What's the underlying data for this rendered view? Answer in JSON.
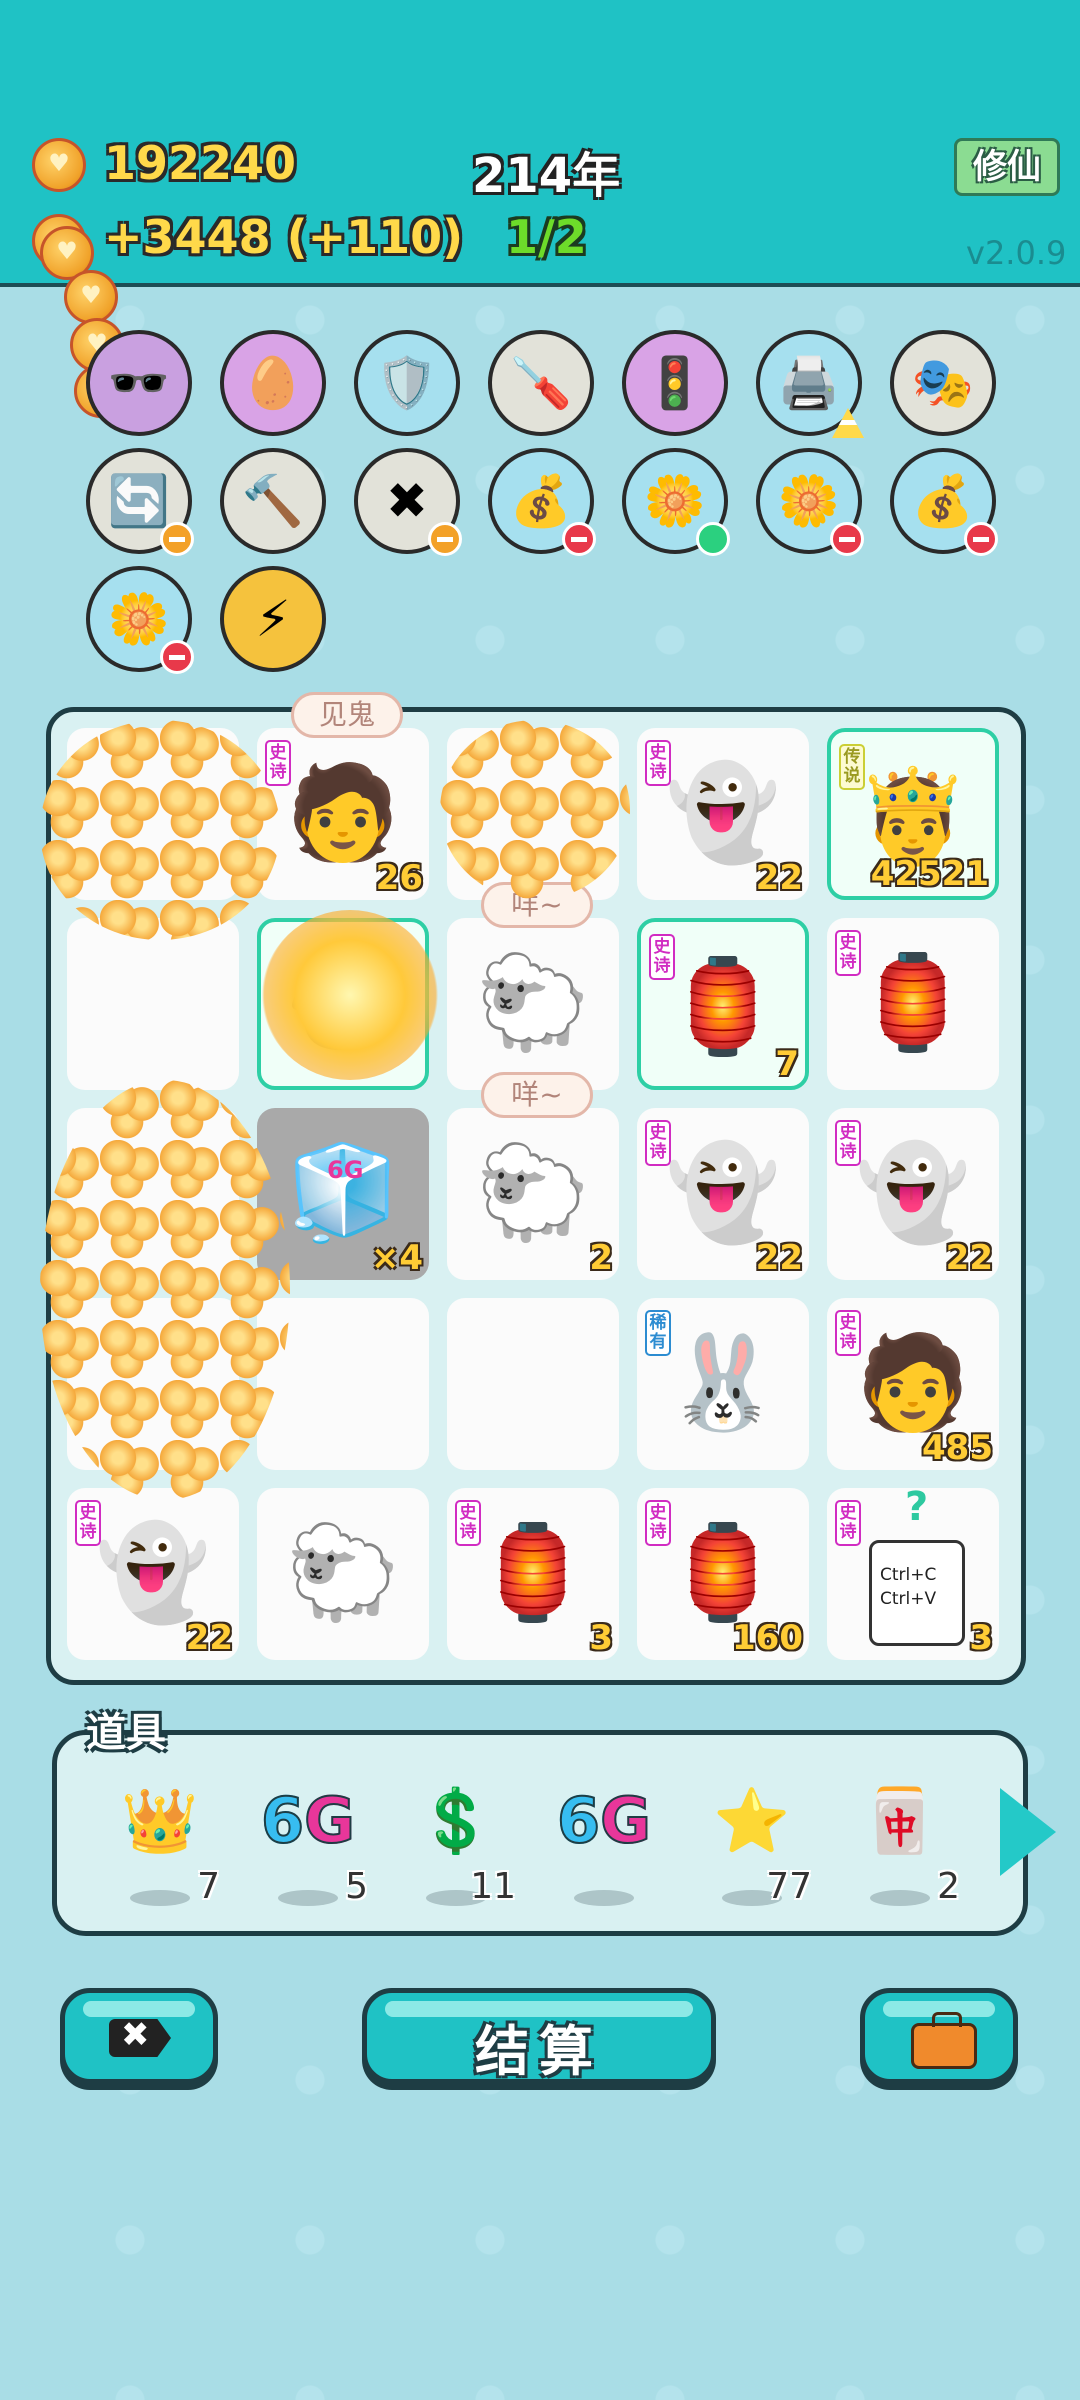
{
  "header": {
    "coins": "192240",
    "income": "+3448 (+110)",
    "year": "214年",
    "progress": "1/2",
    "mode_button": "修仙",
    "version": "v2.0.9"
  },
  "relics": [
    {
      "icon": "sunglasses-icon",
      "glyph": "🕶️",
      "bg": "#c9a0e0"
    },
    {
      "icon": "egg-icon",
      "glyph": "🥚",
      "bg": "#d9a3e6"
    },
    {
      "icon": "shield-wrench-icon",
      "glyph": "🛡️",
      "bg": "#a6e0ef"
    },
    {
      "icon": "screwdriver-icon",
      "glyph": "🪛",
      "bg": "#e2e2d9"
    },
    {
      "icon": "traffic-light-ghost-icon",
      "glyph": "🚦",
      "bg": "#d9a3e6"
    },
    {
      "icon": "printer-icon",
      "glyph": "🖨️",
      "bg": "#a6e0ef",
      "mark": "warn"
    },
    {
      "icon": "golden-mask-icon",
      "glyph": "🎭",
      "bg": "#e2e2d9"
    },
    {
      "icon": "recycle-icon",
      "glyph": "🔄",
      "bg": "#e2e2d9",
      "mark": "heart"
    },
    {
      "icon": "hammer-icon",
      "glyph": "🔨",
      "bg": "#e2e2d9"
    },
    {
      "icon": "remove-tag-icon",
      "glyph": "✖",
      "bg": "#e2e2d9",
      "mark": "heart"
    },
    {
      "icon": "money-bag-icon",
      "glyph": "💰",
      "bg": "#a6e0ef",
      "mark": "minus"
    },
    {
      "icon": "flower-pot-icon",
      "glyph": "🌼",
      "bg": "#a6e0ef",
      "mark": "green"
    },
    {
      "icon": "flower-pot-icon",
      "glyph": "🌼",
      "bg": "#a6e0ef",
      "mark": "minus"
    },
    {
      "icon": "money-bag-icon",
      "glyph": "💰",
      "bg": "#a6e0ef",
      "mark": "minus"
    },
    {
      "icon": "flower-pot-icon",
      "glyph": "🌼",
      "bg": "#a6e0ef",
      "mark": "minus"
    },
    {
      "icon": "lightning-icon",
      "glyph": "⚡",
      "bg": "#f5c23d"
    }
  ],
  "board": {
    "cells": [
      {
        "name": "empty",
        "tag": "",
        "glyph": "",
        "num": ""
      },
      {
        "name": "ghost-man",
        "tag": "史诗",
        "glyph": "🧑",
        "num": "26",
        "bubble": "见鬼"
      },
      {
        "name": "empty",
        "tag": "",
        "glyph": "",
        "num": ""
      },
      {
        "name": "ghost",
        "tag": "史诗",
        "glyph": "👻",
        "num": "22"
      },
      {
        "name": "king",
        "tag": "传说",
        "glyph": "🤴",
        "num": "42521",
        "hl": true
      },
      {
        "name": "empty",
        "tag": "",
        "glyph": "",
        "num": ""
      },
      {
        "name": "pressure-cooker",
        "tag": "",
        "glyph": "🍲",
        "num": "",
        "hl": true
      },
      {
        "name": "sheep",
        "tag": "",
        "glyph": "🐑",
        "num": "",
        "bubble": "咩~"
      },
      {
        "name": "rabbit-house",
        "tag": "史诗",
        "glyph": "🏮",
        "num": "7",
        "hl": true
      },
      {
        "name": "rabbit-house",
        "tag": "史诗",
        "glyph": "🏮",
        "num": ""
      },
      {
        "name": "empty",
        "tag": "",
        "glyph": "",
        "num": ""
      },
      {
        "name": "6g-fridge",
        "tag": "",
        "glyph": "🧊",
        "num": "×4",
        "gray": true,
        "label": "6G"
      },
      {
        "name": "sheep",
        "tag": "",
        "glyph": "🐑",
        "num": "2",
        "bubble": "咩~"
      },
      {
        "name": "ghost",
        "tag": "史诗",
        "glyph": "👻",
        "num": "22"
      },
      {
        "name": "ghost",
        "tag": "史诗",
        "glyph": "👻",
        "num": "22"
      },
      {
        "name": "ghost",
        "tag": "",
        "glyph": "",
        "num": ""
      },
      {
        "name": "empty",
        "tag": "",
        "glyph": "",
        "num": ""
      },
      {
        "name": "empty",
        "tag": "",
        "glyph": "",
        "num": ""
      },
      {
        "name": "rabbit",
        "tag": "稀有",
        "glyph": "🐰",
        "num": "",
        "rare": true
      },
      {
        "name": "ghost-man",
        "tag": "史诗",
        "glyph": "🧑",
        "num": "485"
      },
      {
        "name": "ghost",
        "tag": "史诗",
        "glyph": "👻",
        "num": "22"
      },
      {
        "name": "sheep",
        "tag": "",
        "glyph": "🐑",
        "num": ""
      },
      {
        "name": "rabbit-house",
        "tag": "史诗",
        "glyph": "🏮",
        "num": "3"
      },
      {
        "name": "rabbit-house",
        "tag": "史诗",
        "glyph": "🏮",
        "num": "160"
      },
      {
        "name": "copy-paste-card",
        "tag": "史诗",
        "glyph": "",
        "num": "3",
        "card": [
          "Ctrl+C",
          "Ctrl+V"
        ],
        "q": "?"
      }
    ]
  },
  "items": {
    "title": "道具",
    "list": [
      {
        "icon": "crown-icon",
        "glyph": "👑",
        "count": "7"
      },
      {
        "icon": "6g-icon",
        "glyph": "6G",
        "count": "5",
        "sixg": true
      },
      {
        "icon": "dollar-coin-icon",
        "glyph": "💲",
        "count": "11"
      },
      {
        "icon": "6g-icon",
        "glyph": "6G",
        "count": "",
        "sixg": true
      },
      {
        "icon": "star-icon",
        "glyph": "⭐",
        "count": "77"
      },
      {
        "icon": "rare-cards-icon",
        "glyph": "🀄",
        "count": "2"
      }
    ]
  },
  "buttons": {
    "remove": "remove-tag-icon",
    "settle": "结算",
    "bag": "briefcase-icon"
  }
}
